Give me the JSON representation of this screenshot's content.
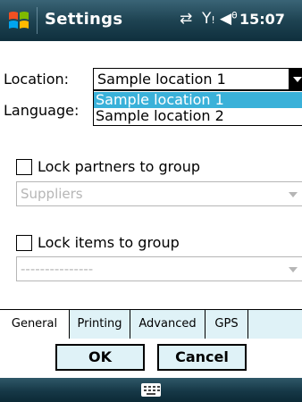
{
  "titlebar": {
    "title": "Settings",
    "time": "15:07",
    "icons": [
      "windows-start-icon",
      "data-sync-icon",
      "signal-icon",
      "volume-icon"
    ]
  },
  "form": {
    "location_label": "Location:",
    "location_value": "Sample location 1",
    "location_options": [
      "Sample location 1",
      "Sample location 2"
    ],
    "language_label": "Language:",
    "lock_partners_label": "Lock partners to group",
    "lock_partners_checked": false,
    "partners_group_value": "Suppliers",
    "lock_items_label": "Lock items to group",
    "lock_items_checked": false,
    "items_group_value": "---------------"
  },
  "tabs": [
    "General",
    "Printing",
    "Advanced",
    "GPS"
  ],
  "buttons": {
    "ok": "OK",
    "cancel": "Cancel"
  },
  "colors": {
    "titlebar": "#1e4352",
    "selection": "#3ab1d9",
    "button_bg": "#dff2f7"
  }
}
